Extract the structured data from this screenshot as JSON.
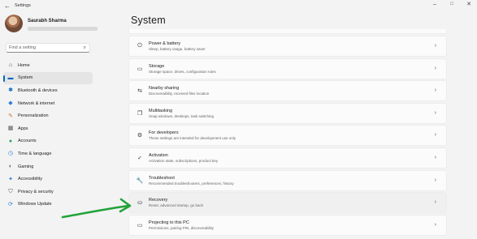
{
  "window": {
    "title": "Settings",
    "back_icon": "back-arrow-icon",
    "controls": {
      "minimize": "–",
      "maximize": "□",
      "close": "✕"
    }
  },
  "profile": {
    "name": "Saurabh Sharma",
    "email_redacted": true
  },
  "search": {
    "placeholder": "Find a setting",
    "value": "",
    "icon": "search-icon"
  },
  "sidebar": {
    "items": [
      {
        "label": "Home",
        "icon": "home-icon",
        "glyph": "⌂",
        "color": "#444444",
        "active": false
      },
      {
        "label": "System",
        "icon": "system-icon",
        "glyph": "▬",
        "color": "#0067c0",
        "active": true
      },
      {
        "label": "Bluetooth & devices",
        "icon": "bluetooth-icon",
        "glyph": "✱",
        "color": "#0067c0",
        "active": false
      },
      {
        "label": "Network & internet",
        "icon": "network-icon",
        "glyph": "◆",
        "color": "#2a7fd4",
        "active": false
      },
      {
        "label": "Personalization",
        "icon": "personalization-icon",
        "glyph": "✎",
        "color": "#d0712f",
        "active": false
      },
      {
        "label": "Apps",
        "icon": "apps-icon",
        "glyph": "▦",
        "color": "#555555",
        "active": false
      },
      {
        "label": "Accounts",
        "icon": "accounts-icon",
        "glyph": "●",
        "color": "#2aa25f",
        "active": false
      },
      {
        "label": "Time & language",
        "icon": "time-language-icon",
        "glyph": "◷",
        "color": "#2a7fd4",
        "active": false
      },
      {
        "label": "Gaming",
        "icon": "gaming-icon",
        "glyph": "◐",
        "color": "#666666",
        "active": false
      },
      {
        "label": "Accessibility",
        "icon": "accessibility-icon",
        "glyph": "✦",
        "color": "#2a7fd4",
        "active": false
      },
      {
        "label": "Privacy & security",
        "icon": "privacy-shield-icon",
        "glyph": "⛉",
        "color": "#555555",
        "active": false
      },
      {
        "label": "Windows Update",
        "icon": "windows-update-icon",
        "glyph": "⟳",
        "color": "#2a7fd4",
        "active": false
      }
    ]
  },
  "main": {
    "title": "System",
    "cards": [
      {
        "title": "Power & battery",
        "subtitle": "Sleep, battery usage, battery saver",
        "icon": "power-icon",
        "glyph": "⏻",
        "highlight": false
      },
      {
        "title": "Storage",
        "subtitle": "Storage space, drives, configuration rules",
        "icon": "storage-icon",
        "glyph": "▭",
        "highlight": false
      },
      {
        "title": "Nearby sharing",
        "subtitle": "Discoverability, received files location",
        "icon": "nearby-sharing-icon",
        "glyph": "⇆",
        "highlight": false
      },
      {
        "title": "Multitasking",
        "subtitle": "Snap windows, desktops, task switching",
        "icon": "multitasking-icon",
        "glyph": "❐",
        "highlight": false
      },
      {
        "title": "For developers",
        "subtitle": "These settings are intended for development use only",
        "icon": "developers-icon",
        "glyph": "⚙",
        "highlight": false
      },
      {
        "title": "Activation",
        "subtitle": "Activation state, subscriptions, product key",
        "icon": "activation-icon",
        "glyph": "✓",
        "highlight": false
      },
      {
        "title": "Troubleshoot",
        "subtitle": "Recommended troubleshooters, preferences, history",
        "icon": "troubleshoot-icon",
        "glyph": "🔧",
        "highlight": false
      },
      {
        "title": "Recovery",
        "subtitle": "Reset, advanced startup, go back",
        "icon": "recovery-icon",
        "glyph": "⛀",
        "highlight": true
      },
      {
        "title": "Projecting to this PC",
        "subtitle": "Permissions, pairing PIN, discoverability",
        "icon": "projecting-icon",
        "glyph": "▭",
        "highlight": false
      }
    ],
    "chevron": "›"
  },
  "annotation": {
    "arrow_color": "#22a33a"
  }
}
